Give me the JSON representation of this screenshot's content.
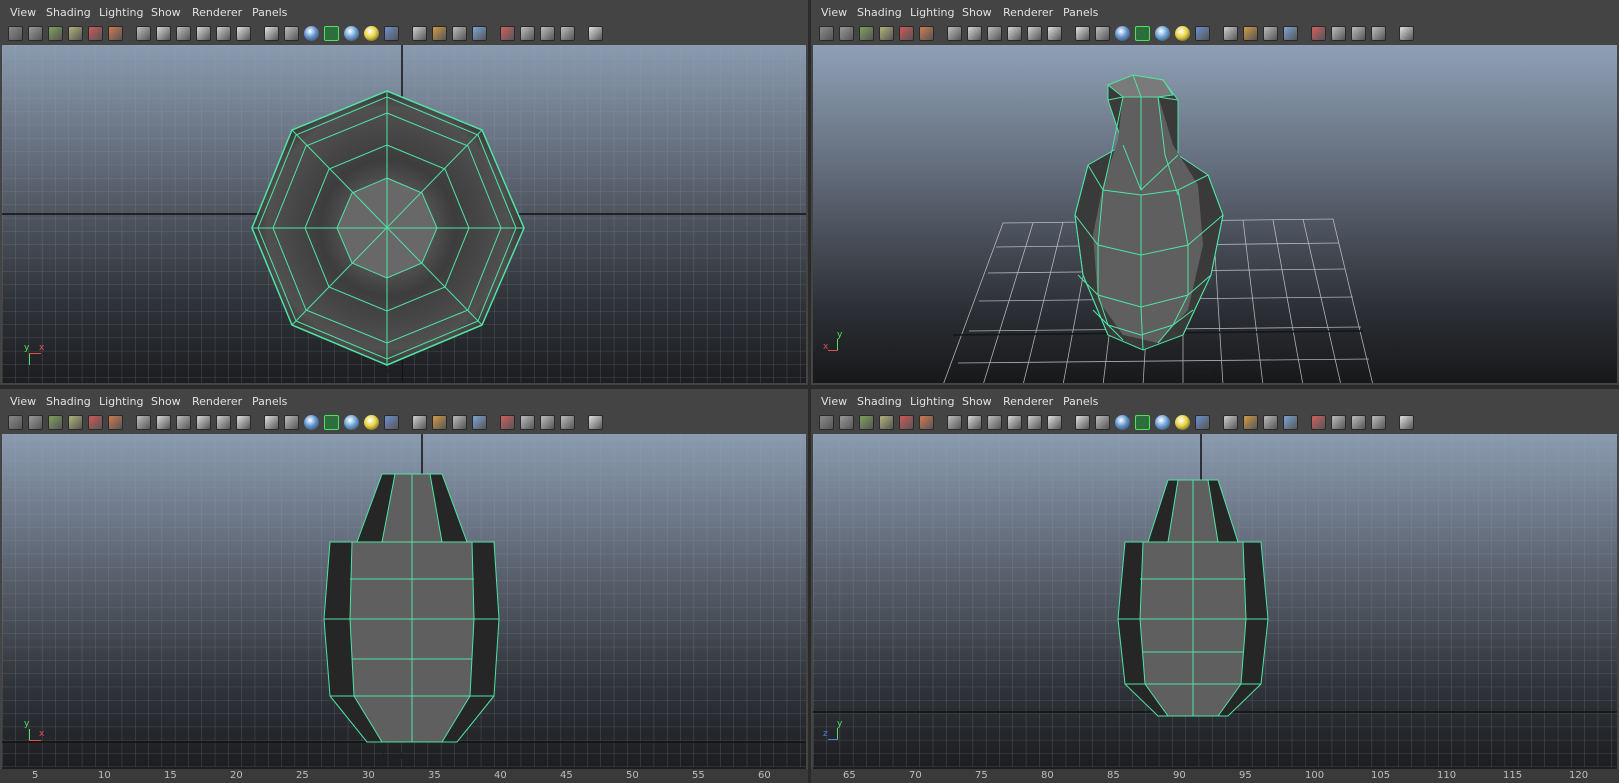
{
  "menu": [
    "View",
    "Shading",
    "Lighting",
    "Show",
    "Renderer",
    "Panels"
  ],
  "toolbar_icons": [
    "camera-attributes-icon",
    "bookmarks-icon",
    "image-plane-icon",
    "2d-pan-zoom-icon",
    "grease-pencil-icon",
    "ruler-icon",
    "grid-icon",
    "film-gate-icon",
    "resolution-gate-icon",
    "gate-mask-icon",
    "field-chart-icon",
    "safe-action-icon",
    "safe-title-icon",
    "wireframe-icon",
    "smooth-shade-icon",
    "wireframe-on-shaded-icon",
    "textured-icon",
    "use-all-lights-icon",
    "shadows-icon",
    "screen-space-ao-icon",
    "motion-blur-icon",
    "multisample-aa-icon",
    "depth-of-field-icon",
    "select-camera-icon",
    "isolate-select-icon",
    "xray-icon",
    "xray-joints-icon",
    "node-editor-icon"
  ],
  "viewports": {
    "top_left": {
      "camera": "top",
      "axis_v": "y",
      "axis_h": "x"
    },
    "top_right": {
      "camera": "persp",
      "axis_v": "y",
      "axis_h": "x"
    },
    "bottom_left": {
      "camera": "front",
      "axis_v": "y",
      "axis_h": "x"
    },
    "bottom_right": {
      "camera": "side",
      "axis_v": "y",
      "axis_h": "z"
    }
  },
  "ruler_left": [
    "5",
    "10",
    "15",
    "20",
    "25",
    "30",
    "35",
    "40",
    "45",
    "50",
    "55",
    "60"
  ],
  "ruler_right": [
    "65",
    "70",
    "75",
    "80",
    "85",
    "90",
    "95",
    "100",
    "105",
    "110",
    "115",
    "120"
  ],
  "colors": {
    "wire": "#4fe3a4",
    "panel_bg": "#444444",
    "mesh_face": "#5f5f5f"
  }
}
